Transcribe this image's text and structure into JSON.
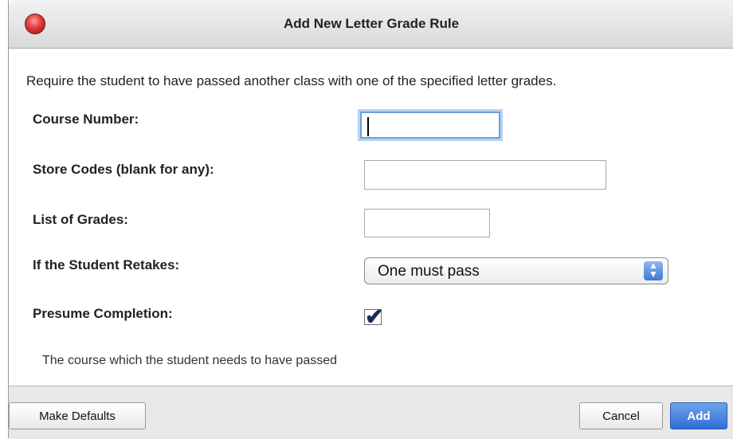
{
  "window": {
    "title": "Add New Letter Grade Rule"
  },
  "description": "Require the student to have passed another class with one of the specified letter grades.",
  "form": {
    "course_number_label": "Course Number:",
    "course_number_value": "",
    "store_codes_label": "Store Codes (blank for any):",
    "store_codes_value": "",
    "grades_label": "List of Grades:",
    "grades_value": "",
    "retakes_label": "If the Student Retakes:",
    "retakes_selected": "One must pass",
    "presume_label": "Presume Completion:",
    "presume_checked": true
  },
  "help_text": "The course which the student needs to have passed",
  "buttons": {
    "make_defaults": "Make Defaults",
    "cancel": "Cancel",
    "add": "Add"
  },
  "colors": {
    "accent": "#2f6fd4",
    "focus_ring": "#6d9fdd",
    "close_button": "#e03a3a"
  }
}
